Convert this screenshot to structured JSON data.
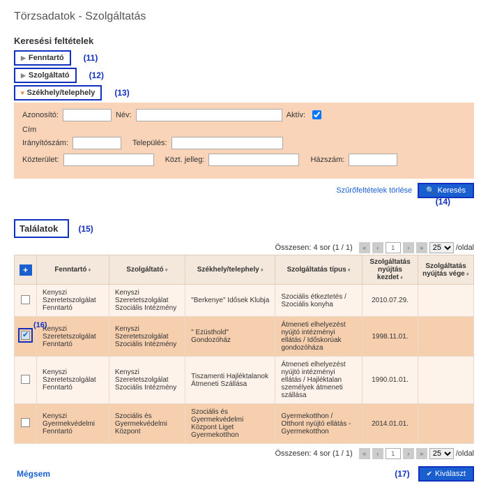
{
  "title": "Törzsadatok - Szolgáltatás",
  "search_heading": "Keresési feltételek",
  "accordion": {
    "fenntarto": {
      "label": "Fenntartó",
      "anno": "(11)"
    },
    "szolgaltato": {
      "label": "Szolgáltató",
      "anno": "(12)"
    },
    "szekhely": {
      "label": "Székhely/telephely",
      "anno": "(13)"
    }
  },
  "form": {
    "azonosito_lbl": "Azonosító:",
    "nev_lbl": "Név:",
    "aktiv_lbl": "Aktív:",
    "cim_lbl": "Cím",
    "irsz_lbl": "Irányítószám:",
    "telepules_lbl": "Település:",
    "kozterulet_lbl": "Közterület:",
    "koztjelleg_lbl": "Közt. jelleg:",
    "hazszam_lbl": "Házszám:"
  },
  "actions": {
    "clear_filters": "Szűrőfeltételek törlése",
    "search": "Keresés",
    "search_anno": "(14)",
    "select": "Kiválaszt",
    "select_anno": "(17)",
    "cancel": "Mégsem"
  },
  "results": {
    "heading": "Találatok",
    "heading_anno": "(15)",
    "summary": "Összesen: 4 sor (1 / 1)",
    "page_num": "1",
    "per_page": "25",
    "per_page_suffix": "/oldal",
    "columns": {
      "plus": "+",
      "fenntarto": "Fenntartó",
      "szolgaltato": "Szolgáltató",
      "szekhely": "Székhely/telephely",
      "tipus": "Szolgáltatás típus",
      "kezdet": "Szolgáltatás nyújtás kezdet",
      "vege": "Szolgáltatás nyújtás vége"
    },
    "rows": [
      {
        "fenntarto": "Kenyszi Szeretetszolgálat Fenntartó",
        "szolgaltato": "Kenyszi Szeretetszolgálat Szociális Intézmény",
        "szekhely": "\"Berkenye\" Idősek Klubja",
        "tipus": "Szociális étkeztetés / Szociális konyha",
        "kezdet": "2010.07.29.",
        "vege": "",
        "checked": false
      },
      {
        "fenntarto": "Kenyszi Szeretetszolgálat Fenntartó",
        "szolgaltato": "Kenyszi Szeretetszolgálat Szociális Intézmény",
        "szekhely": "\" Ezüsthold\" Gondozóház",
        "tipus": "Átmeneti elhelyezést nyújtó intézményi ellátás / Időskorúak gondozóháza",
        "kezdet": "1998.11.01.",
        "vege": "",
        "checked": true,
        "anno": "(16)"
      },
      {
        "fenntarto": "Kenyszi Szeretetszolgálat Fenntartó",
        "szolgaltato": "Kenyszi Szeretetszolgálat Szociális Intézmény",
        "szekhely": "Tiszamenti Hajléktalanok Átmeneti Szállása",
        "tipus": "Átmeneti elhelyezést nyújtó intézményi ellátás / Hajléktalan személyek átmeneti szállása",
        "kezdet": "1990.01.01.",
        "vege": "",
        "checked": false
      },
      {
        "fenntarto": "Kenyszi Gyermekvédelmi Fenntartó",
        "szolgaltato": "Szociális és Gyermekvédelmi Központ",
        "szekhely": "Szociális és Gyermekvédelmi Központ Liget Gyermekotthon",
        "tipus": "Gyermekotthon / Otthont nyújtó ellátás - Gyermekotthon",
        "kezdet": "2014.01.01.",
        "vege": "",
        "checked": false
      }
    ]
  }
}
